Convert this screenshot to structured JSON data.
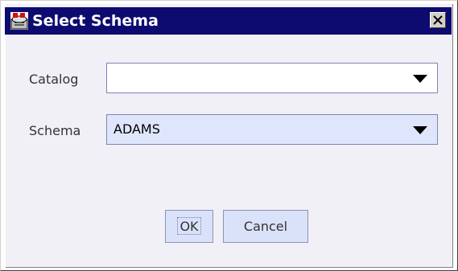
{
  "window": {
    "title": "Select Schema",
    "icon": "app-icon",
    "close_icon": "close-icon"
  },
  "form": {
    "catalog_label": "Catalog",
    "catalog_value": "",
    "schema_label": "Schema",
    "schema_value": "ADAMS"
  },
  "buttons": {
    "ok_label": "OK",
    "cancel_label": "Cancel"
  },
  "colors": {
    "titlebar": "#0d0b70",
    "dialog_bg": "#f0f0f6",
    "combo_border": "#7c84b8",
    "combo_fill": "#dfe6fb",
    "button_fill": "#d9e2f8"
  }
}
